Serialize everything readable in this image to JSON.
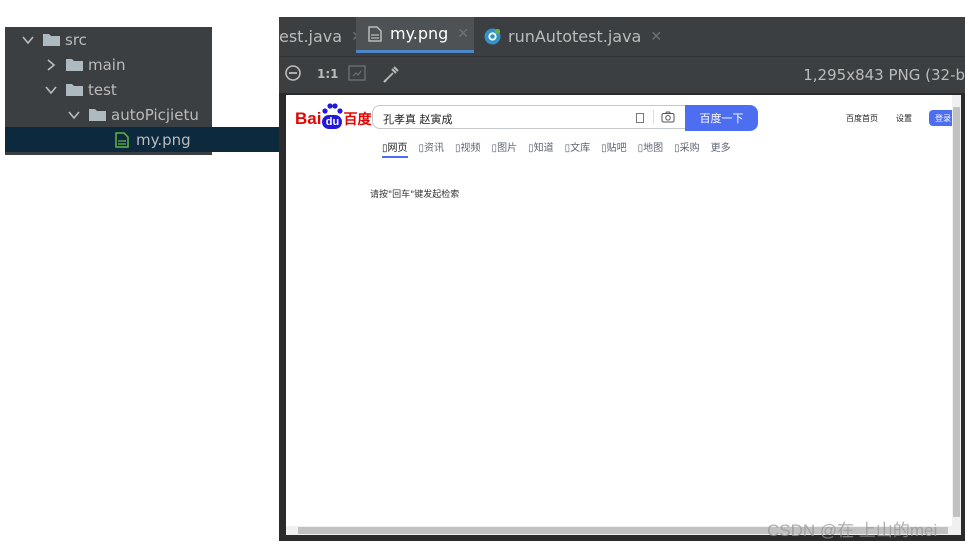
{
  "tree": {
    "items": [
      {
        "label": "src",
        "expanded": true
      },
      {
        "label": "main",
        "expanded": false
      },
      {
        "label": "test",
        "expanded": true
      },
      {
        "label": "autoPicjietu",
        "expanded": true
      },
      {
        "label": "my.png",
        "selected": true
      }
    ]
  },
  "tabs": [
    {
      "label": "est.java",
      "close": "✕",
      "active": false
    },
    {
      "label": "my.png",
      "close": "✕",
      "active": true
    },
    {
      "label": "runAutotest.java",
      "close": "✕",
      "active": false
    }
  ],
  "toolbar": {
    "zoom_actual": "1:1",
    "image_info": "1,295x843 PNG (32-b"
  },
  "preview": {
    "logo_bai": "Bai",
    "logo_du": "du",
    "logo_baidu": "百度",
    "search_value": "孔孝真 赵寅成",
    "search_button": "百度一下",
    "nav_tabs": [
      "网页",
      "资讯",
      "视频",
      "图片",
      "知道",
      "文库",
      "贴吧",
      "地图",
      "采购",
      "更多"
    ],
    "hint": "请按\"回车\"键发起检索",
    "top_links": [
      "百度首页",
      "设置"
    ],
    "login": "登录"
  },
  "watermark": "CSDN @在 上山的mei"
}
